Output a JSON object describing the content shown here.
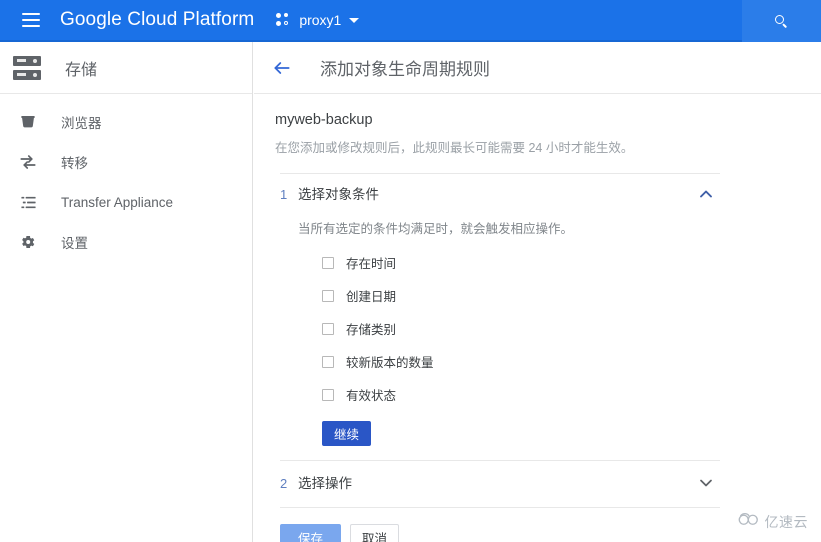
{
  "topbar": {
    "menu_icon": "hamburger-menu-icon",
    "brand": "Google Cloud Platform",
    "project": {
      "icon": "project-dots-icon",
      "name": "proxy1",
      "caret": "chevron-down-icon"
    },
    "search": {
      "icon": "search-icon",
      "placeholder": ""
    },
    "accent_color": "#1b72e8"
  },
  "sidebar": {
    "header": {
      "icon": "storage-server-icon",
      "title": "存储"
    },
    "items": [
      {
        "icon": "bucket-icon",
        "label": "浏览器"
      },
      {
        "icon": "transfer-arrows-icon",
        "label": "转移"
      },
      {
        "icon": "list-icon",
        "label": "Transfer Appliance"
      },
      {
        "icon": "gear-icon",
        "label": "设置"
      }
    ]
  },
  "content": {
    "back_icon": "back-arrow-icon",
    "title": "添加对象生命周期规则",
    "bucket_name": "myweb-backup",
    "notice": "在您添加或修改规则后，此规则最长可能需要 24 小时才能生效。",
    "steps": [
      {
        "number": "1",
        "title": "选择对象条件",
        "description": "当所有选定的条件均满足时，就会触发相应操作。",
        "expanded": true,
        "chevron": "chevron-up-icon",
        "chevron_color": "#3f5fa8",
        "checkboxes": [
          {
            "label": "存在时间",
            "checked": false
          },
          {
            "label": "创建日期",
            "checked": false
          },
          {
            "label": "存储类别",
            "checked": false
          },
          {
            "label": "较新版本的数量",
            "checked": false
          },
          {
            "label": "有效状态",
            "checked": false
          }
        ],
        "continue_label": "继续"
      },
      {
        "number": "2",
        "title": "选择操作",
        "expanded": false,
        "chevron": "chevron-down-icon",
        "chevron_color": "#5f6368"
      }
    ],
    "footer": {
      "save_label": "保存",
      "save_color": "#7aa7ee",
      "cancel_label": "取消"
    }
  },
  "watermark": {
    "logo": "cloud-logo-icon",
    "text": "亿速云"
  }
}
